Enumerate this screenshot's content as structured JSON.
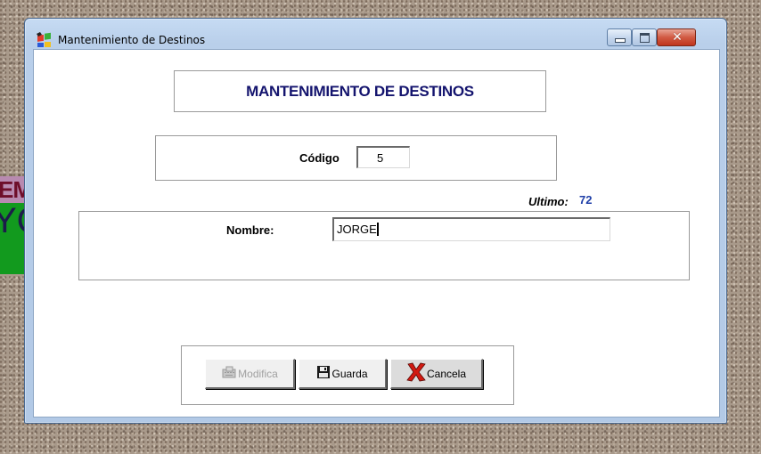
{
  "window": {
    "title": "Mantenimiento de Destinos"
  },
  "background": {
    "fragment_1": "EM",
    "fragment_2": "YC"
  },
  "form": {
    "header": "MANTENIMIENTO DE DESTINOS",
    "codigo_label": "Código",
    "codigo_value": "5",
    "ultimo_label": "Ultimo:",
    "ultimo_value": "72",
    "nombre_label": "Nombre:",
    "nombre_value": "JORGE"
  },
  "buttons": {
    "modifica": {
      "label": "Modifica",
      "enabled": false,
      "icon": "keyboard-icon"
    },
    "guarda": {
      "label": "Guarda",
      "enabled": true,
      "icon": "floppy-disk-icon"
    },
    "cancela": {
      "label": "Cancela",
      "enabled": true,
      "icon": "red-x-icon"
    }
  },
  "colors": {
    "header_text": "#14146e",
    "ultimo_value": "#1f3fa8",
    "close_button": "#c0351e"
  }
}
